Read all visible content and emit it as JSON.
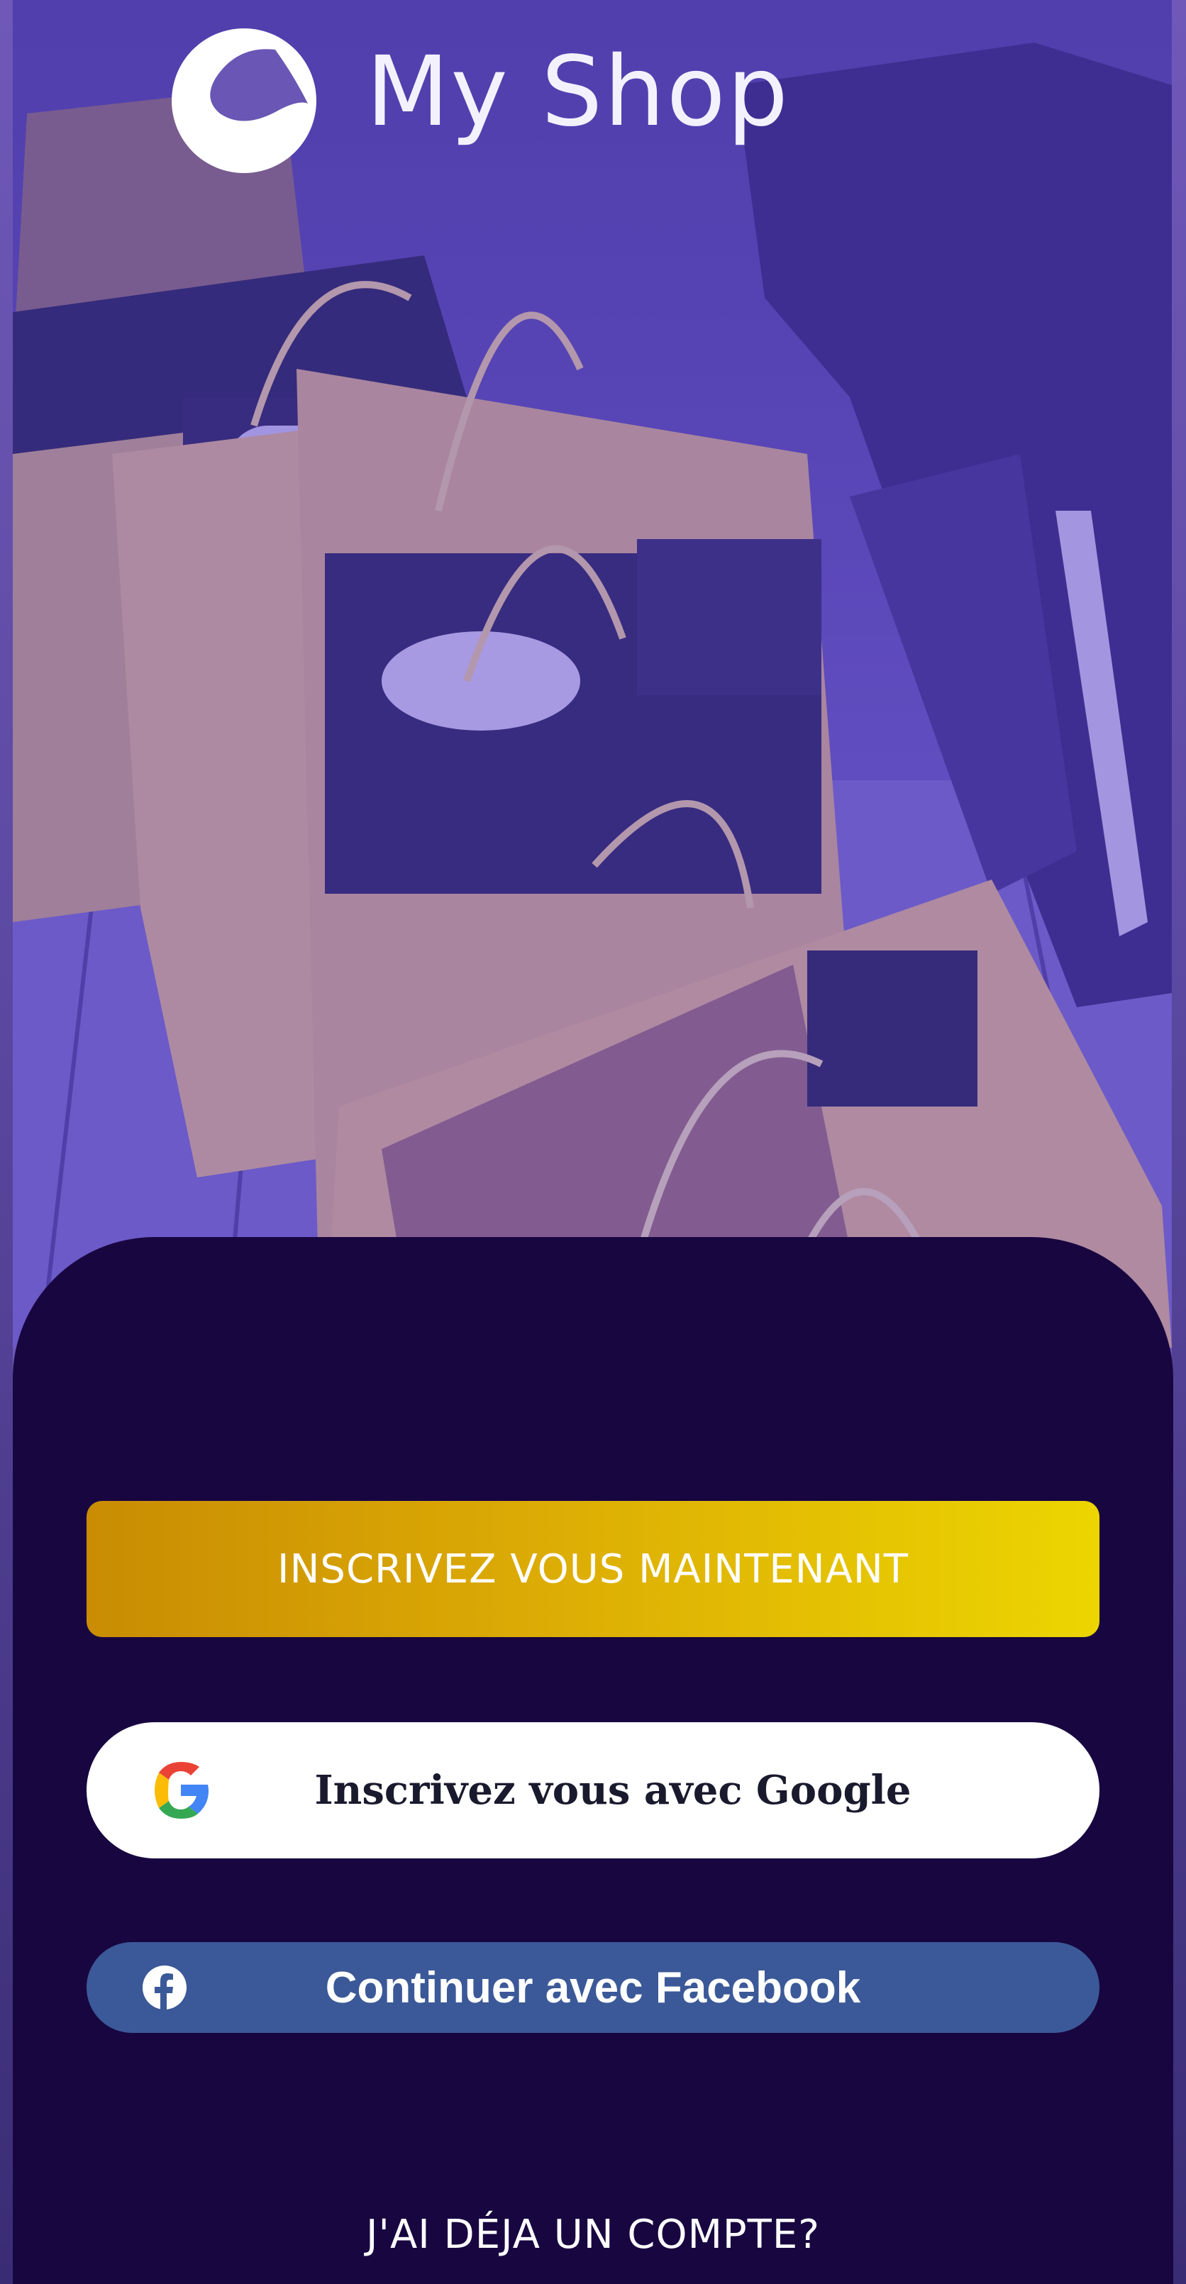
{
  "app": {
    "title": "My Shop",
    "logo_icon": "shop-logo-icon"
  },
  "hero": {
    "image": "shopping-bags-photo"
  },
  "actions": {
    "signup_label": "INSCRIVEZ VOUS MAINTENANT",
    "google_label": "Inscrivez vous avec Google",
    "facebook_label": "Continuer avec Facebook",
    "login_label": "J'AI DÉJA UN COMPTE?"
  },
  "colors": {
    "panel_bg": "#180640",
    "signup_gradient_start": "#c98c03",
    "signup_gradient_end": "#ecd501",
    "facebook_blue": "#3b5998",
    "hero_tint": "#5746ad"
  }
}
